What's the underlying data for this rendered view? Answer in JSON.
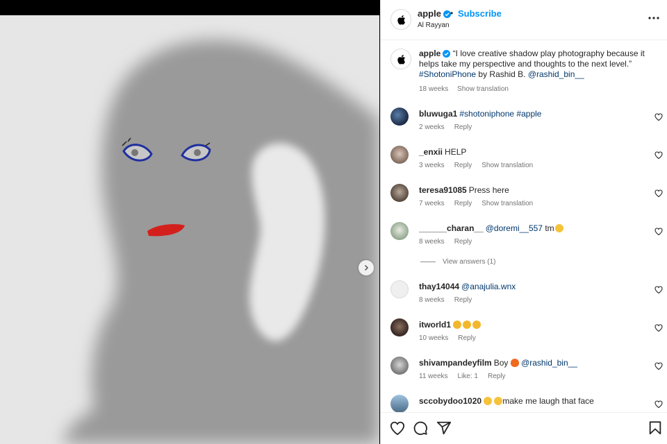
{
  "post": {
    "photo_alt": "",
    "next_icon": "chevron-right-icon"
  },
  "header": {
    "username": "apple",
    "dot": "•",
    "subscribe_label": "Subscribe",
    "location": "Al Rayyan",
    "more_icon": "more-horizontal-icon"
  },
  "caption": {
    "username": "apple",
    "quote": "“I love creative shadow play photography because it helps take my perspective and thoughts to the next level.”",
    "hashtag": "#ShotoniPhone",
    "by": "by Rashid B.",
    "mention": "@rashid_bin__",
    "time": "18 weeks",
    "translate": "Show translation"
  },
  "comments": [
    {
      "user": "bluwuga1",
      "text": "",
      "link": "#shotoniphone #apple",
      "time": "2 weeks",
      "likes": "",
      "reply": "Reply",
      "translate": ""
    },
    {
      "user": "_enxii",
      "text": "HELP",
      "link": "",
      "time": "3 weeks",
      "likes": "",
      "reply": "Reply",
      "translate": "Show translation"
    },
    {
      "user": "teresa91085",
      "text": "Press here",
      "link": "",
      "time": "7 weeks",
      "likes": "",
      "reply": "Reply",
      "translate": "Show translation"
    },
    {
      "user": "______charan__",
      "text": "",
      "link": "@doremi__557",
      "after": "tm",
      "time": "8 weeks",
      "likes": "",
      "reply": "Reply",
      "translate": ""
    },
    {
      "user": "thay14044",
      "text": "",
      "link": "@anajulia.wnx",
      "time": "8 weeks",
      "likes": "",
      "reply": "Reply",
      "translate": ""
    },
    {
      "user": "itworld1",
      "text": "",
      "link": "",
      "time": "10 weeks",
      "likes": "",
      "reply": "Reply",
      "translate": ""
    },
    {
      "user": "shivampandeyfilm",
      "text": "Boy",
      "link": "@rashid_bin__",
      "time": "11 weeks",
      "likes": "Like: 1",
      "reply": "Reply",
      "translate": ""
    },
    {
      "user": "sccobydoo1020",
      "text": "make me laugh that face",
      "link": "",
      "time": "",
      "likes": "",
      "reply": "",
      "translate": ""
    }
  ],
  "view_answers": "View answers (1)",
  "actions": {
    "like_icon": "heart-icon",
    "comment_icon": "comment-icon",
    "share_icon": "send-icon",
    "save_icon": "bookmark-icon"
  },
  "colors": {
    "link": "#00376b",
    "subscribe": "#0095f6",
    "verified": "#0095f6",
    "muted": "#737373"
  }
}
